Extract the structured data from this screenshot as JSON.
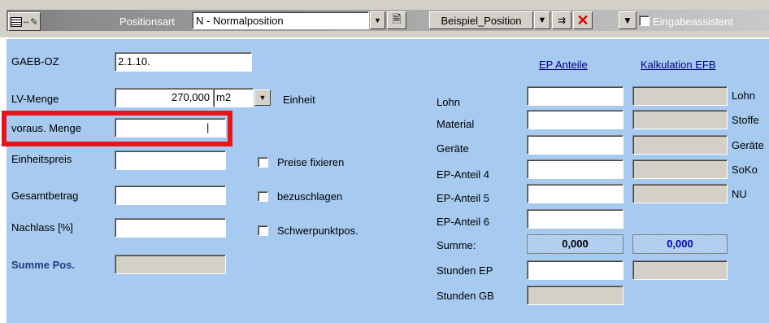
{
  "toolbar": {
    "positionsart_label": "Positionsart",
    "positionsart_value": "N - Normalposition",
    "template_value": "Beispiel_Position",
    "eingabeassistent_label": "Eingabeassistent"
  },
  "form": {
    "gaeb_oz": {
      "label": "GAEB-OZ",
      "value": "2.1.10."
    },
    "lv_menge": {
      "label": "LV-Menge",
      "value": "270,000",
      "unit": "m2",
      "unit_label": "Einheit"
    },
    "voraus_menge": {
      "label": "voraus. Menge",
      "value": "|"
    },
    "einheitspreis": {
      "label": "Einheitspreis",
      "value": ""
    },
    "gesamtbetrag": {
      "label": "Gesamtbetrag",
      "value": ""
    },
    "nachlass": {
      "label": "Nachlass [%]",
      "value": ""
    },
    "summe_pos": {
      "label": "Summe Pos.",
      "value": ""
    },
    "checks": {
      "preise_fixieren": "Preise fixieren",
      "bezuschlagen": "bezuschlagen",
      "schwerpunktpos": "Schwerpunktpos."
    },
    "ep_anteile_header": "EP Anteile",
    "kalkulation_header": "Kalkulation EFB",
    "ep_rows": [
      "Lohn",
      "Material",
      "Geräte",
      "EP-Anteil 4",
      "EP-Anteil 5",
      "EP-Anteil 6"
    ],
    "right_labels": [
      "Lohn",
      "Stoffe",
      "Geräte",
      "SoKo",
      "NU"
    ],
    "summe_label": "Summe:",
    "summe_ep": "0,000",
    "summe_kalk": "0,000",
    "stunden_ep_label": "Stunden EP",
    "stunden_gb_label": "Stunden GB"
  },
  "colors": {
    "form_bg": "#a6caf0",
    "highlight": "#e8141c",
    "link": "#000080"
  }
}
